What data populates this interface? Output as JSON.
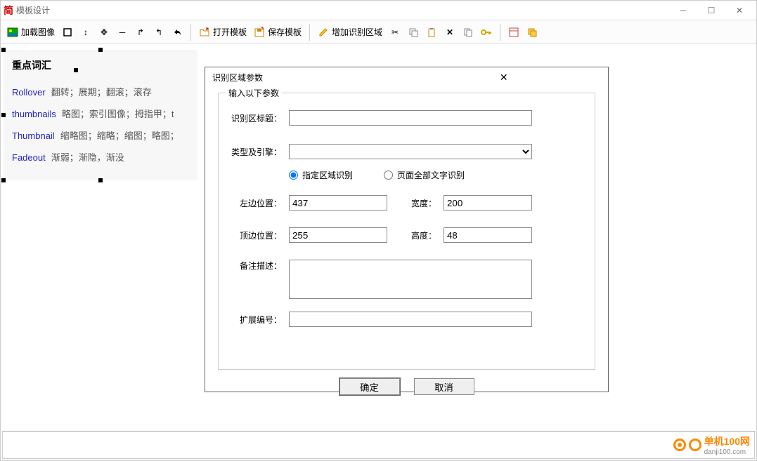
{
  "window": {
    "title": "模板设计"
  },
  "toolbar": {
    "load_image": "加载图像",
    "open_template": "打开模板",
    "save_template": "保存模板",
    "add_region": "增加识别区域"
  },
  "doc": {
    "heading": "重点词汇",
    "items": [
      {
        "term": "Rollover",
        "def": "翻转；展期；翻滚；滚存"
      },
      {
        "term": "thumbnails",
        "def": "略图；索引图像；拇指甲；t"
      },
      {
        "term": "Thumbnail",
        "def": "缩略图；缩略；缩图；略图；"
      },
      {
        "term": "Fadeout",
        "def": "渐弱；渐隐，渐没"
      }
    ]
  },
  "dialog": {
    "title": "识别区域参数",
    "legend": "输入以下参数",
    "labels": {
      "region_title": "识别区标题：",
      "type_engine": "类型及引擎：",
      "radio_region": "指定区域识别",
      "radio_page": "页面全部文字识别",
      "left": "左边位置：",
      "top": "顶边位置：",
      "width": "宽度：",
      "height": "高度：",
      "remark": "备注描述：",
      "ext_id": "扩展编号："
    },
    "values": {
      "region_title": "",
      "left": "437",
      "top": "255",
      "width": "200",
      "height": "48",
      "remark": "",
      "ext_id": ""
    },
    "buttons": {
      "ok": "确定",
      "cancel": "取消"
    }
  },
  "branding": {
    "name": "单机100网",
    "url": "danji100.com"
  }
}
